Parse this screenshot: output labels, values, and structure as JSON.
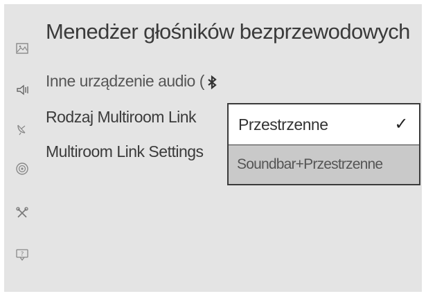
{
  "header": {
    "title": "Menedżer głośników bezprzewodowych"
  },
  "sidebar": {
    "icons": [
      "picture-icon",
      "speaker-icon",
      "satellite-dish-icon",
      "broadcast-icon",
      "tools-icon",
      "support-icon"
    ]
  },
  "menu": {
    "items": [
      {
        "label": "Inne urządzenie audio ("
      },
      {
        "label": "Rodzaj Multiroom Link"
      },
      {
        "label": "Multiroom Link Settings"
      }
    ]
  },
  "dropdown": {
    "options": [
      {
        "label": "Przestrzenne",
        "check": "✓"
      },
      {
        "label": "Soundbar+Przestrzenne"
      }
    ]
  },
  "colors": {
    "background": "#e4e4e4",
    "selected": "#ffffff",
    "unselected": "#c9c9c9",
    "text": "#3a3a3a"
  }
}
